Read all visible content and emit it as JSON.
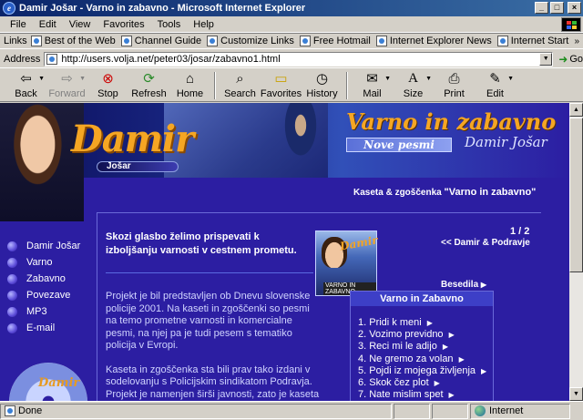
{
  "window": {
    "title": "Damir Jošar - Varno in zabavno - Microsoft Internet Explorer",
    "app_icon": "ie-icon",
    "buttons": [
      "_",
      "□",
      "×"
    ]
  },
  "menu": [
    "File",
    "Edit",
    "View",
    "Favorites",
    "Tools",
    "Help"
  ],
  "links": {
    "label": "Links",
    "items": [
      "Best of the Web",
      "Channel Guide",
      "Customize Links",
      "Free Hotmail",
      "Internet Explorer News",
      "Internet Start"
    ],
    "more": "»"
  },
  "address": {
    "label": "Address",
    "url": "http://users.volja.net/peter03/josar/zabavno1.html",
    "go_label": "Go"
  },
  "toolbar": {
    "back": "Back",
    "forward": "Forward",
    "stop": "Stop",
    "refresh": "Refresh",
    "home": "Home",
    "search": "Search",
    "favorites": "Favorites",
    "history": "History",
    "mail": "Mail",
    "size": "Size",
    "print": "Print",
    "edit": "Edit"
  },
  "page": {
    "banner": {
      "name": "Damir",
      "surname": "Jošar",
      "album_title": "Varno in zabavno",
      "new_songs": "Nove pesmi",
      "signature": "Damir Jošar"
    },
    "kaseta_prefix": "Kaseta & zgoščenka",
    "kaseta_title": "\"Varno in zabavno\"",
    "nav": [
      "Damir Jošar",
      "Varno",
      "Zabavno",
      "Povezave",
      "MP3",
      "E-mail"
    ],
    "intro": "Skozi glasbo želimo prispevati k izboljšanju varnosti v cestnem prometu.",
    "pagination": "1 / 2",
    "back_link": "<< Damir & Podravje",
    "cover": {
      "name": "Damir",
      "title": "VARNO IN ZABAVNO"
    },
    "body": [
      "Projekt je bil predstavljen ob Dnevu slovenske policije 2001. Na kaseti in zgoščenki so pesmi na temo prometne varnosti in komercialne pesmi, na njej pa je tudi pesem s tematiko policija v Evropi.",
      "Kaseta in zgoščenka sta bili prav tako izdani v sodelovanju s Policijskim sindikatom Podravja. Projekt je namenjen širši javnosti, zato je kaseta in zgoščenka naprodaj v trgovinah."
    ],
    "lyrics_link": "Besedila",
    "songs_header": "Varno in Zabavno",
    "songs": [
      "1. Pridi k meni",
      "2. Vozimo previdno",
      "3. Reci mi le adijo",
      "4. Ne gremo za volan",
      "5. Pojdi iz mojega življenja",
      "6. Skok čez plot",
      "7. Nate mislim spet"
    ],
    "song_arrow": "▶"
  },
  "status": {
    "text": "Done",
    "zone": "Internet"
  },
  "colors": {
    "page_bg": "#2c1ea2",
    "accent_orange": "#f5a623",
    "titlebar": "#0a246a"
  }
}
